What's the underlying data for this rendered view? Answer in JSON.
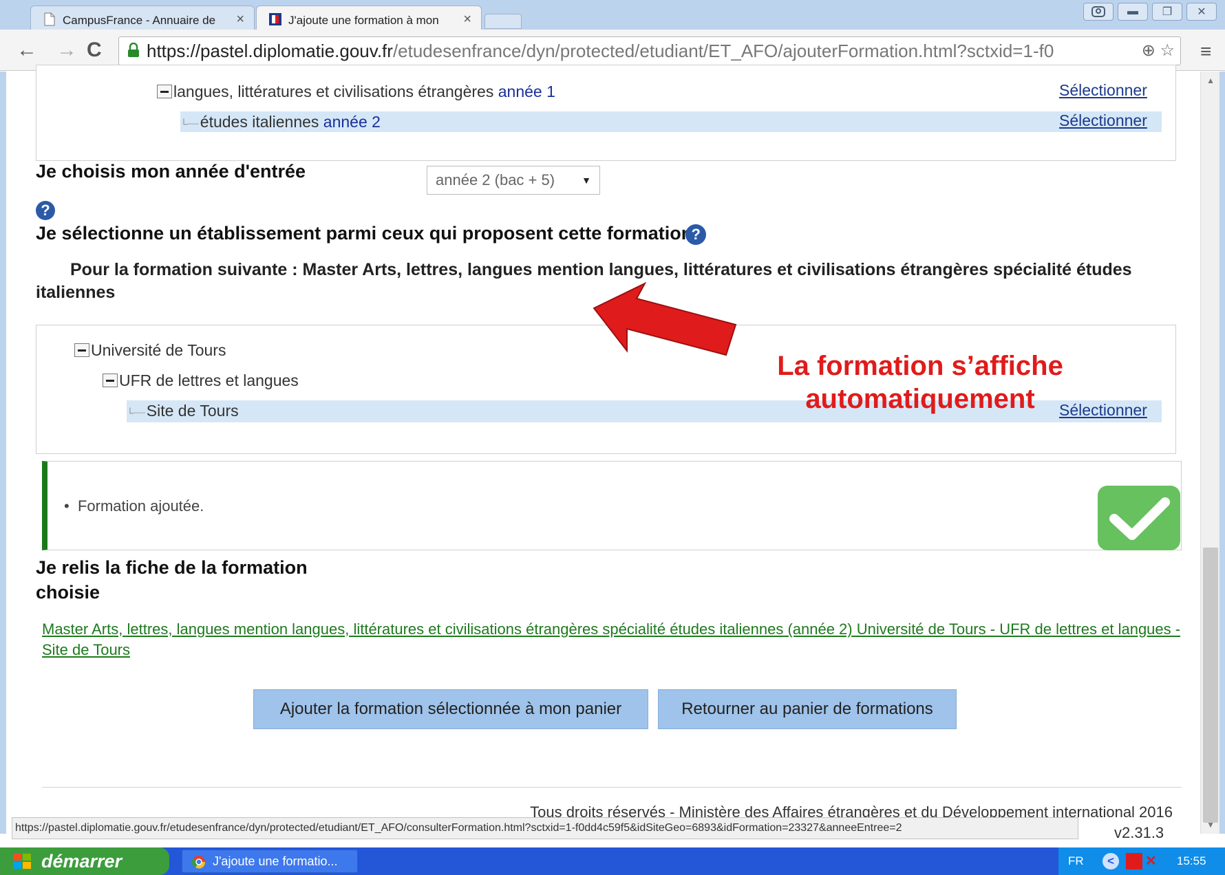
{
  "browser": {
    "tabs": [
      {
        "title": "CampusFrance - Annuaire de"
      },
      {
        "title": "J'ajoute une formation à mon"
      }
    ],
    "url_host": "https://pastel.diplomatie.gouv.fr",
    "url_path": "/etudesenfrance/dyn/protected/etudiant/ET_AFO/ajouterFormation.html?sctxid=1-f0"
  },
  "tree1": {
    "rows": [
      {
        "label": "langues, littératures et civilisations étrangères",
        "year": "année 1",
        "select": "Sélectionner"
      },
      {
        "label": "études italiennes",
        "year": "année 2",
        "select": "Sélectionner"
      }
    ]
  },
  "entry": {
    "heading": "Je choisis mon année d'entrée",
    "selected_year": "année 2 (bac + 5)"
  },
  "establishment": {
    "heading": "Je sélectionne un établissement parmi ceux qui proposent cette formation",
    "formation_text": "Pour la formation suivante : Master Arts, lettres, langues mention langues, littératures et civilisations étrangères spécialité études italiennes",
    "tree": [
      {
        "label": "Université de Tours"
      },
      {
        "label": "UFR de lettres et langues"
      },
      {
        "label": "Site de Tours",
        "select": "Sélectionner"
      }
    ]
  },
  "annotation": "La formation s’affiche automatiquement",
  "message": "Formation ajoutée.",
  "review": {
    "heading_line1": "Je relis la fiche de la formation",
    "heading_line2": "choisie",
    "link": "Master Arts, lettres, langues mention langues, littératures et civilisations étrangères spécialité études italiennes (année 2) Université de Tours - UFR de lettres et langues - Site de Tours"
  },
  "buttons": {
    "add": "Ajouter la formation sélectionnée à mon panier",
    "back": "Retourner au panier de formations"
  },
  "footer": {
    "copyright": "Tous droits réservés - Ministère des Affaires étrangères et du Développement international 2016",
    "version": "v2.31.3"
  },
  "statusbar": "https://pastel.diplomatie.gouv.fr/etudesenfrance/dyn/protected/etudiant/ET_AFO/consulterFormation.html?sctxid=1-f0dd4c59f5&idSiteGeo=6893&idFormation=23327&anneeEntree=2",
  "taskbar": {
    "start": "démarrer",
    "task": "J'ajoute une formatio...",
    "lang": "FR",
    "time": "15:55"
  },
  "colors": {
    "accent_red": "#e01b1b",
    "success_green": "#67c15e",
    "link_green": "#1d7a1d",
    "button_blue": "#9fc3ea"
  }
}
